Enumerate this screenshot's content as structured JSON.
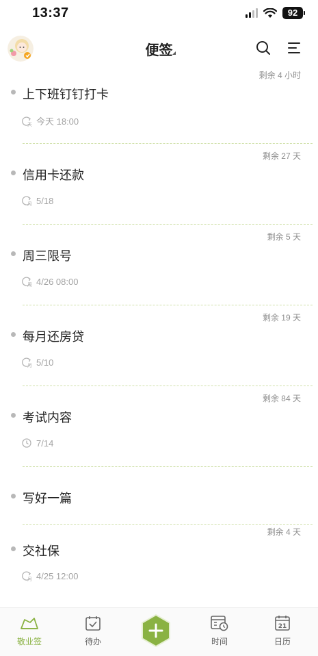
{
  "status_bar": {
    "time": "13:37",
    "battery": "92"
  },
  "header": {
    "title": "便签",
    "avatar_icon": "avatar-icon",
    "search_icon": "search-icon",
    "menu_icon": "menu-icon"
  },
  "notes": [
    {
      "title": "上下班钉钉打卡",
      "remaining": "剩余 4 小时",
      "meta": "今天 18:00",
      "meta_icon": "repeat-daily-icon"
    },
    {
      "title": "信用卡还款",
      "remaining": "剩余 27 天",
      "meta": "5/18",
      "meta_icon": "repeat-monthly-icon"
    },
    {
      "title": "周三限号",
      "remaining": "剩余 5 天",
      "meta": "4/26 08:00",
      "meta_icon": "repeat-weekly-icon"
    },
    {
      "title": "每月还房贷",
      "remaining": "剩余 19 天",
      "meta": "5/10",
      "meta_icon": "repeat-monthly-icon"
    },
    {
      "title": "考试内容",
      "remaining": "剩余 84 天",
      "meta": "7/14",
      "meta_icon": "clock-icon"
    },
    {
      "title": "写好一篇",
      "remaining": "",
      "meta": "",
      "meta_icon": ""
    },
    {
      "title": "交社保",
      "remaining": "剩余 4 天",
      "meta": "4/25 12:00",
      "meta_icon": "repeat-monthly-icon"
    }
  ],
  "tabbar": {
    "items": [
      {
        "label": "敬业签",
        "icon": "notebook-icon",
        "active": true
      },
      {
        "label": "待办",
        "icon": "todo-check-icon",
        "active": false
      },
      {
        "label": "",
        "icon": "add-icon",
        "active": false
      },
      {
        "label": "时间",
        "icon": "timeline-icon",
        "active": false
      },
      {
        "label": "日历",
        "icon": "calendar-icon",
        "active": false
      }
    ],
    "calendar_day": "21"
  },
  "colors": {
    "accent": "#8ab243",
    "divider": "#cfe0a8",
    "muted": "#a3a3a3"
  }
}
